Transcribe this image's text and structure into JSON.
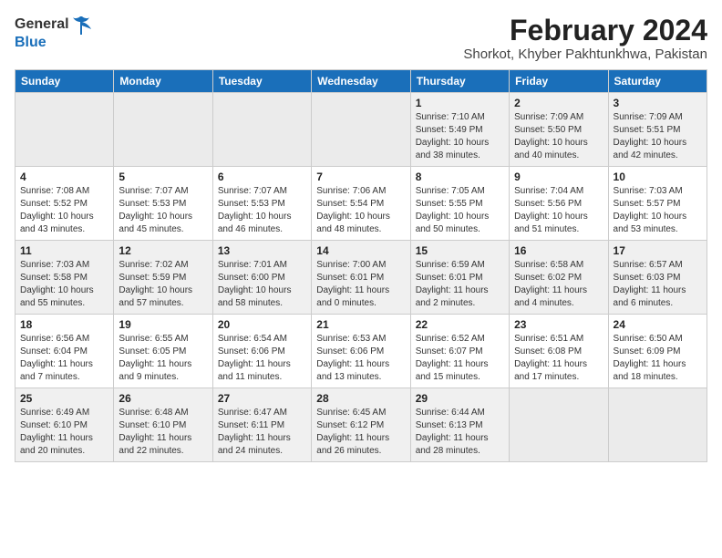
{
  "logo": {
    "general": "General",
    "blue": "Blue"
  },
  "title": {
    "month": "February 2024",
    "location": "Shorkot, Khyber Pakhtunkhwa, Pakistan"
  },
  "headers": [
    "Sunday",
    "Monday",
    "Tuesday",
    "Wednesday",
    "Thursday",
    "Friday",
    "Saturday"
  ],
  "weeks": [
    [
      {
        "day": "",
        "info": ""
      },
      {
        "day": "",
        "info": ""
      },
      {
        "day": "",
        "info": ""
      },
      {
        "day": "",
        "info": ""
      },
      {
        "day": "1",
        "info": "Sunrise: 7:10 AM\nSunset: 5:49 PM\nDaylight: 10 hours\nand 38 minutes."
      },
      {
        "day": "2",
        "info": "Sunrise: 7:09 AM\nSunset: 5:50 PM\nDaylight: 10 hours\nand 40 minutes."
      },
      {
        "day": "3",
        "info": "Sunrise: 7:09 AM\nSunset: 5:51 PM\nDaylight: 10 hours\nand 42 minutes."
      }
    ],
    [
      {
        "day": "4",
        "info": "Sunrise: 7:08 AM\nSunset: 5:52 PM\nDaylight: 10 hours\nand 43 minutes."
      },
      {
        "day": "5",
        "info": "Sunrise: 7:07 AM\nSunset: 5:53 PM\nDaylight: 10 hours\nand 45 minutes."
      },
      {
        "day": "6",
        "info": "Sunrise: 7:07 AM\nSunset: 5:53 PM\nDaylight: 10 hours\nand 46 minutes."
      },
      {
        "day": "7",
        "info": "Sunrise: 7:06 AM\nSunset: 5:54 PM\nDaylight: 10 hours\nand 48 minutes."
      },
      {
        "day": "8",
        "info": "Sunrise: 7:05 AM\nSunset: 5:55 PM\nDaylight: 10 hours\nand 50 minutes."
      },
      {
        "day": "9",
        "info": "Sunrise: 7:04 AM\nSunset: 5:56 PM\nDaylight: 10 hours\nand 51 minutes."
      },
      {
        "day": "10",
        "info": "Sunrise: 7:03 AM\nSunset: 5:57 PM\nDaylight: 10 hours\nand 53 minutes."
      }
    ],
    [
      {
        "day": "11",
        "info": "Sunrise: 7:03 AM\nSunset: 5:58 PM\nDaylight: 10 hours\nand 55 minutes."
      },
      {
        "day": "12",
        "info": "Sunrise: 7:02 AM\nSunset: 5:59 PM\nDaylight: 10 hours\nand 57 minutes."
      },
      {
        "day": "13",
        "info": "Sunrise: 7:01 AM\nSunset: 6:00 PM\nDaylight: 10 hours\nand 58 minutes."
      },
      {
        "day": "14",
        "info": "Sunrise: 7:00 AM\nSunset: 6:01 PM\nDaylight: 11 hours\nand 0 minutes."
      },
      {
        "day": "15",
        "info": "Sunrise: 6:59 AM\nSunset: 6:01 PM\nDaylight: 11 hours\nand 2 minutes."
      },
      {
        "day": "16",
        "info": "Sunrise: 6:58 AM\nSunset: 6:02 PM\nDaylight: 11 hours\nand 4 minutes."
      },
      {
        "day": "17",
        "info": "Sunrise: 6:57 AM\nSunset: 6:03 PM\nDaylight: 11 hours\nand 6 minutes."
      }
    ],
    [
      {
        "day": "18",
        "info": "Sunrise: 6:56 AM\nSunset: 6:04 PM\nDaylight: 11 hours\nand 7 minutes."
      },
      {
        "day": "19",
        "info": "Sunrise: 6:55 AM\nSunset: 6:05 PM\nDaylight: 11 hours\nand 9 minutes."
      },
      {
        "day": "20",
        "info": "Sunrise: 6:54 AM\nSunset: 6:06 PM\nDaylight: 11 hours\nand 11 minutes."
      },
      {
        "day": "21",
        "info": "Sunrise: 6:53 AM\nSunset: 6:06 PM\nDaylight: 11 hours\nand 13 minutes."
      },
      {
        "day": "22",
        "info": "Sunrise: 6:52 AM\nSunset: 6:07 PM\nDaylight: 11 hours\nand 15 minutes."
      },
      {
        "day": "23",
        "info": "Sunrise: 6:51 AM\nSunset: 6:08 PM\nDaylight: 11 hours\nand 17 minutes."
      },
      {
        "day": "24",
        "info": "Sunrise: 6:50 AM\nSunset: 6:09 PM\nDaylight: 11 hours\nand 18 minutes."
      }
    ],
    [
      {
        "day": "25",
        "info": "Sunrise: 6:49 AM\nSunset: 6:10 PM\nDaylight: 11 hours\nand 20 minutes."
      },
      {
        "day": "26",
        "info": "Sunrise: 6:48 AM\nSunset: 6:10 PM\nDaylight: 11 hours\nand 22 minutes."
      },
      {
        "day": "27",
        "info": "Sunrise: 6:47 AM\nSunset: 6:11 PM\nDaylight: 11 hours\nand 24 minutes."
      },
      {
        "day": "28",
        "info": "Sunrise: 6:45 AM\nSunset: 6:12 PM\nDaylight: 11 hours\nand 26 minutes."
      },
      {
        "day": "29",
        "info": "Sunrise: 6:44 AM\nSunset: 6:13 PM\nDaylight: 11 hours\nand 28 minutes."
      },
      {
        "day": "",
        "info": ""
      },
      {
        "day": "",
        "info": ""
      }
    ]
  ]
}
